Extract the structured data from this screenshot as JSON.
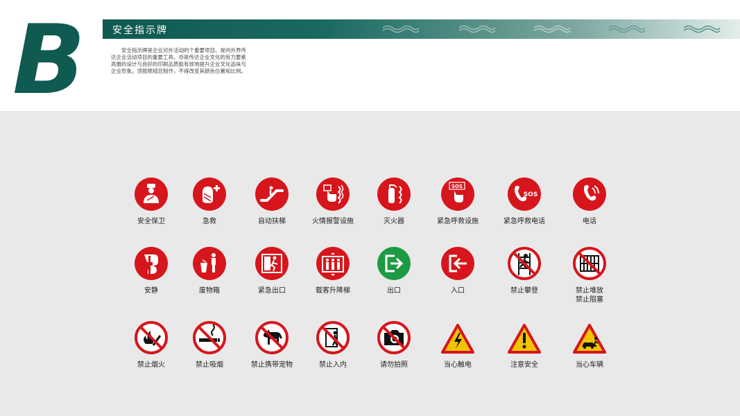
{
  "header": {
    "section_letter": "B",
    "title": "安全指示牌",
    "intro": "安全指示牌是企业对外活动的个重要项目。是向外界传达企业活动项目的重要工具，亦是传达企业文化的有力要素高雅的设计与良好的印刷品质能有效地提升企业文化品味与企业形象。须按照规范制作，不得改变其颜色位置和比例。"
  },
  "colors": {
    "brand_green": "#0f5a51",
    "sign_red": "#d6161c",
    "exit_green": "#1e9a45",
    "warning_yellow": "#f3c300"
  },
  "signs": [
    {
      "label": "安全保卫",
      "icon": "guard-icon"
    },
    {
      "label": "急救",
      "icon": "first-aid-icon"
    },
    {
      "label": "自动扶梯",
      "icon": "escalator-icon"
    },
    {
      "label": "火情报警设施",
      "icon": "fire-alarm-icon"
    },
    {
      "label": "灭火器",
      "icon": "fire-extinguisher-icon"
    },
    {
      "label": "紧急呼救设施",
      "icon": "sos-button-icon"
    },
    {
      "label": "紧急呼救电话",
      "icon": "sos-phone-icon"
    },
    {
      "label": "电话",
      "icon": "telephone-icon"
    },
    {
      "label": "安静",
      "icon": "quiet-icon"
    },
    {
      "label": "废物箱",
      "icon": "trash-bin-icon"
    },
    {
      "label": "紧急出口",
      "icon": "emergency-exit-icon"
    },
    {
      "label": "载客升降梯",
      "icon": "elevator-icon"
    },
    {
      "label": "出口",
      "icon": "exit-icon"
    },
    {
      "label": "入口",
      "icon": "entrance-icon"
    },
    {
      "label": "禁止攀登",
      "icon": "no-climbing-icon"
    },
    {
      "label": "禁止堆放\n禁止阻塞",
      "icon": "no-stacking-icon"
    },
    {
      "label": "禁止烟火",
      "icon": "no-fire-icon"
    },
    {
      "label": "禁止吸烟",
      "icon": "no-smoking-icon"
    },
    {
      "label": "禁止携带宠物",
      "icon": "no-pets-icon"
    },
    {
      "label": "禁止入内",
      "icon": "no-entry-icon"
    },
    {
      "label": "请勿拍照",
      "icon": "no-photo-icon"
    },
    {
      "label": "当心触电",
      "icon": "electric-hazard-icon"
    },
    {
      "label": "注意安全",
      "icon": "caution-icon"
    },
    {
      "label": "当心车辆",
      "icon": "vehicle-warning-icon"
    }
  ]
}
